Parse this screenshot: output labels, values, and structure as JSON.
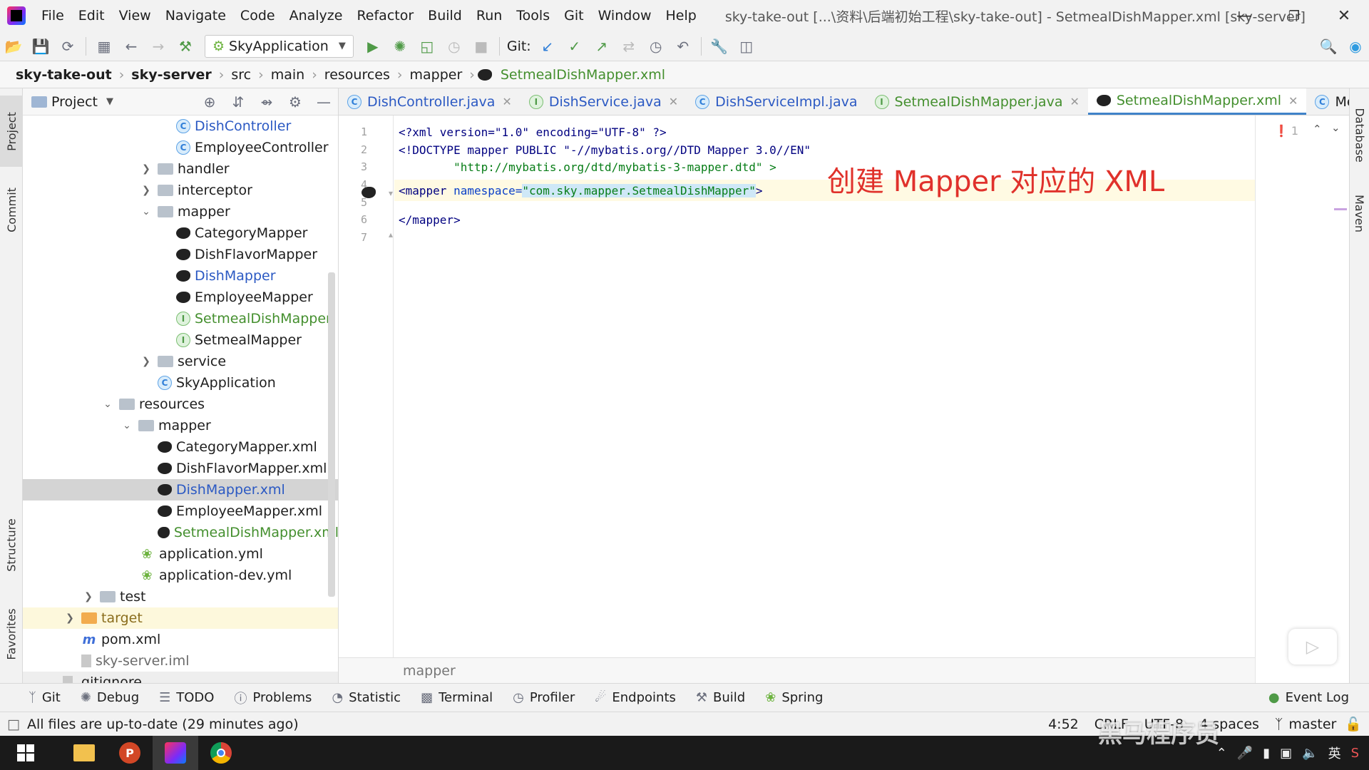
{
  "menubar": {
    "items": [
      "File",
      "Edit",
      "View",
      "Navigate",
      "Code",
      "Analyze",
      "Refactor",
      "Build",
      "Run",
      "Tools",
      "Git",
      "Window",
      "Help"
    ],
    "window_title": "sky-take-out [...\\资料\\后端初始工程\\sky-take-out] - SetmealDishMapper.xml [sky-server]"
  },
  "toolbar": {
    "run_config": "SkyApplication",
    "git_label": "Git:"
  },
  "breadcrumb": [
    "sky-take-out",
    "sky-server",
    "src",
    "main",
    "resources",
    "mapper",
    "SetmealDishMapper.xml"
  ],
  "left_stripe": {
    "project": "Project",
    "commit": "Commit",
    "structure": "Structure",
    "favorites": "Favorites"
  },
  "right_stripe": {
    "database": "Database",
    "maven": "Maven"
  },
  "project_panel": {
    "title": "Project",
    "rows": [
      {
        "label": "DishController",
        "icon": "class"
      },
      {
        "label": "EmployeeController",
        "icon": "class"
      },
      {
        "label": "handler",
        "icon": "folder"
      },
      {
        "label": "interceptor",
        "icon": "folder"
      },
      {
        "label": "mapper",
        "icon": "folder"
      },
      {
        "label": "CategoryMapper",
        "icon": "mybatis"
      },
      {
        "label": "DishFlavorMapper",
        "icon": "mybatis"
      },
      {
        "label": "DishMapper",
        "icon": "mybatis"
      },
      {
        "label": "EmployeeMapper",
        "icon": "mybatis"
      },
      {
        "label": "SetmealDishMapper",
        "icon": "interface"
      },
      {
        "label": "SetmealMapper",
        "icon": "interface"
      },
      {
        "label": "service",
        "icon": "folder"
      },
      {
        "label": "SkyApplication",
        "icon": "spring-class"
      },
      {
        "label": "resources",
        "icon": "folder"
      },
      {
        "label": "mapper",
        "icon": "folder"
      },
      {
        "label": "CategoryMapper.xml",
        "icon": "mybatis"
      },
      {
        "label": "DishFlavorMapper.xml",
        "icon": "mybatis"
      },
      {
        "label": "DishMapper.xml",
        "icon": "mybatis"
      },
      {
        "label": "EmployeeMapper.xml",
        "icon": "mybatis"
      },
      {
        "label": "SetmealDishMapper.xml",
        "icon": "mybatis"
      },
      {
        "label": "application.yml",
        "icon": "spring"
      },
      {
        "label": "application-dev.yml",
        "icon": "spring"
      },
      {
        "label": "test",
        "icon": "folder"
      },
      {
        "label": "target",
        "icon": "folder-orange"
      },
      {
        "label": "pom.xml",
        "icon": "maven"
      },
      {
        "label": "sky-server.iml",
        "icon": "file"
      },
      {
        "label": ".gitignore",
        "icon": "file"
      }
    ]
  },
  "editor_tabs": [
    {
      "label": "DishController.java",
      "icon": "class"
    },
    {
      "label": "DishService.java",
      "icon": "interface"
    },
    {
      "label": "DishServiceImpl.java",
      "icon": "class"
    },
    {
      "label": "SetmealDishMapper.java",
      "icon": "interface"
    },
    {
      "label": "SetmealDishMapper.xml",
      "icon": "mybatis",
      "active": true
    },
    {
      "label": "Messa",
      "icon": "class"
    }
  ],
  "editor": {
    "line_numbers": [
      "1",
      "2",
      "3",
      "4",
      "5",
      "6",
      "7"
    ],
    "line1": "<?xml version=\"1.0\" encoding=\"UTF-8\" ?>",
    "line2": "<!DOCTYPE mapper PUBLIC \"-//mybatis.org//DTD Mapper 3.0//EN\"",
    "line3": "        \"http://mybatis.org/dtd/mybatis-3-mapper.dtd\" >",
    "line4_tag": "<mapper ",
    "line4_attr": "namespace=",
    "line4_value": "\"com.sky.mapper.SetmealDishMapper\"",
    "line4_end": ">",
    "line6": "</mapper>",
    "annotation": "创建 Mapper 对应的 XML",
    "problems_count": "1",
    "footer": "mapper"
  },
  "bottom_tabs": [
    "Git",
    "Debug",
    "TODO",
    "Problems",
    "Statistic",
    "Terminal",
    "Profiler",
    "Endpoints",
    "Build",
    "Spring"
  ],
  "event_log": "Event Log",
  "status": {
    "message": "All files are up-to-date (29 minutes ago)",
    "position": "4:52",
    "line_sep": "CRLF",
    "encoding": "UTF-8",
    "indent": "4 spaces",
    "branch": "master"
  },
  "taskbar": {
    "ime": "英"
  },
  "watermark": "黑马程序员"
}
